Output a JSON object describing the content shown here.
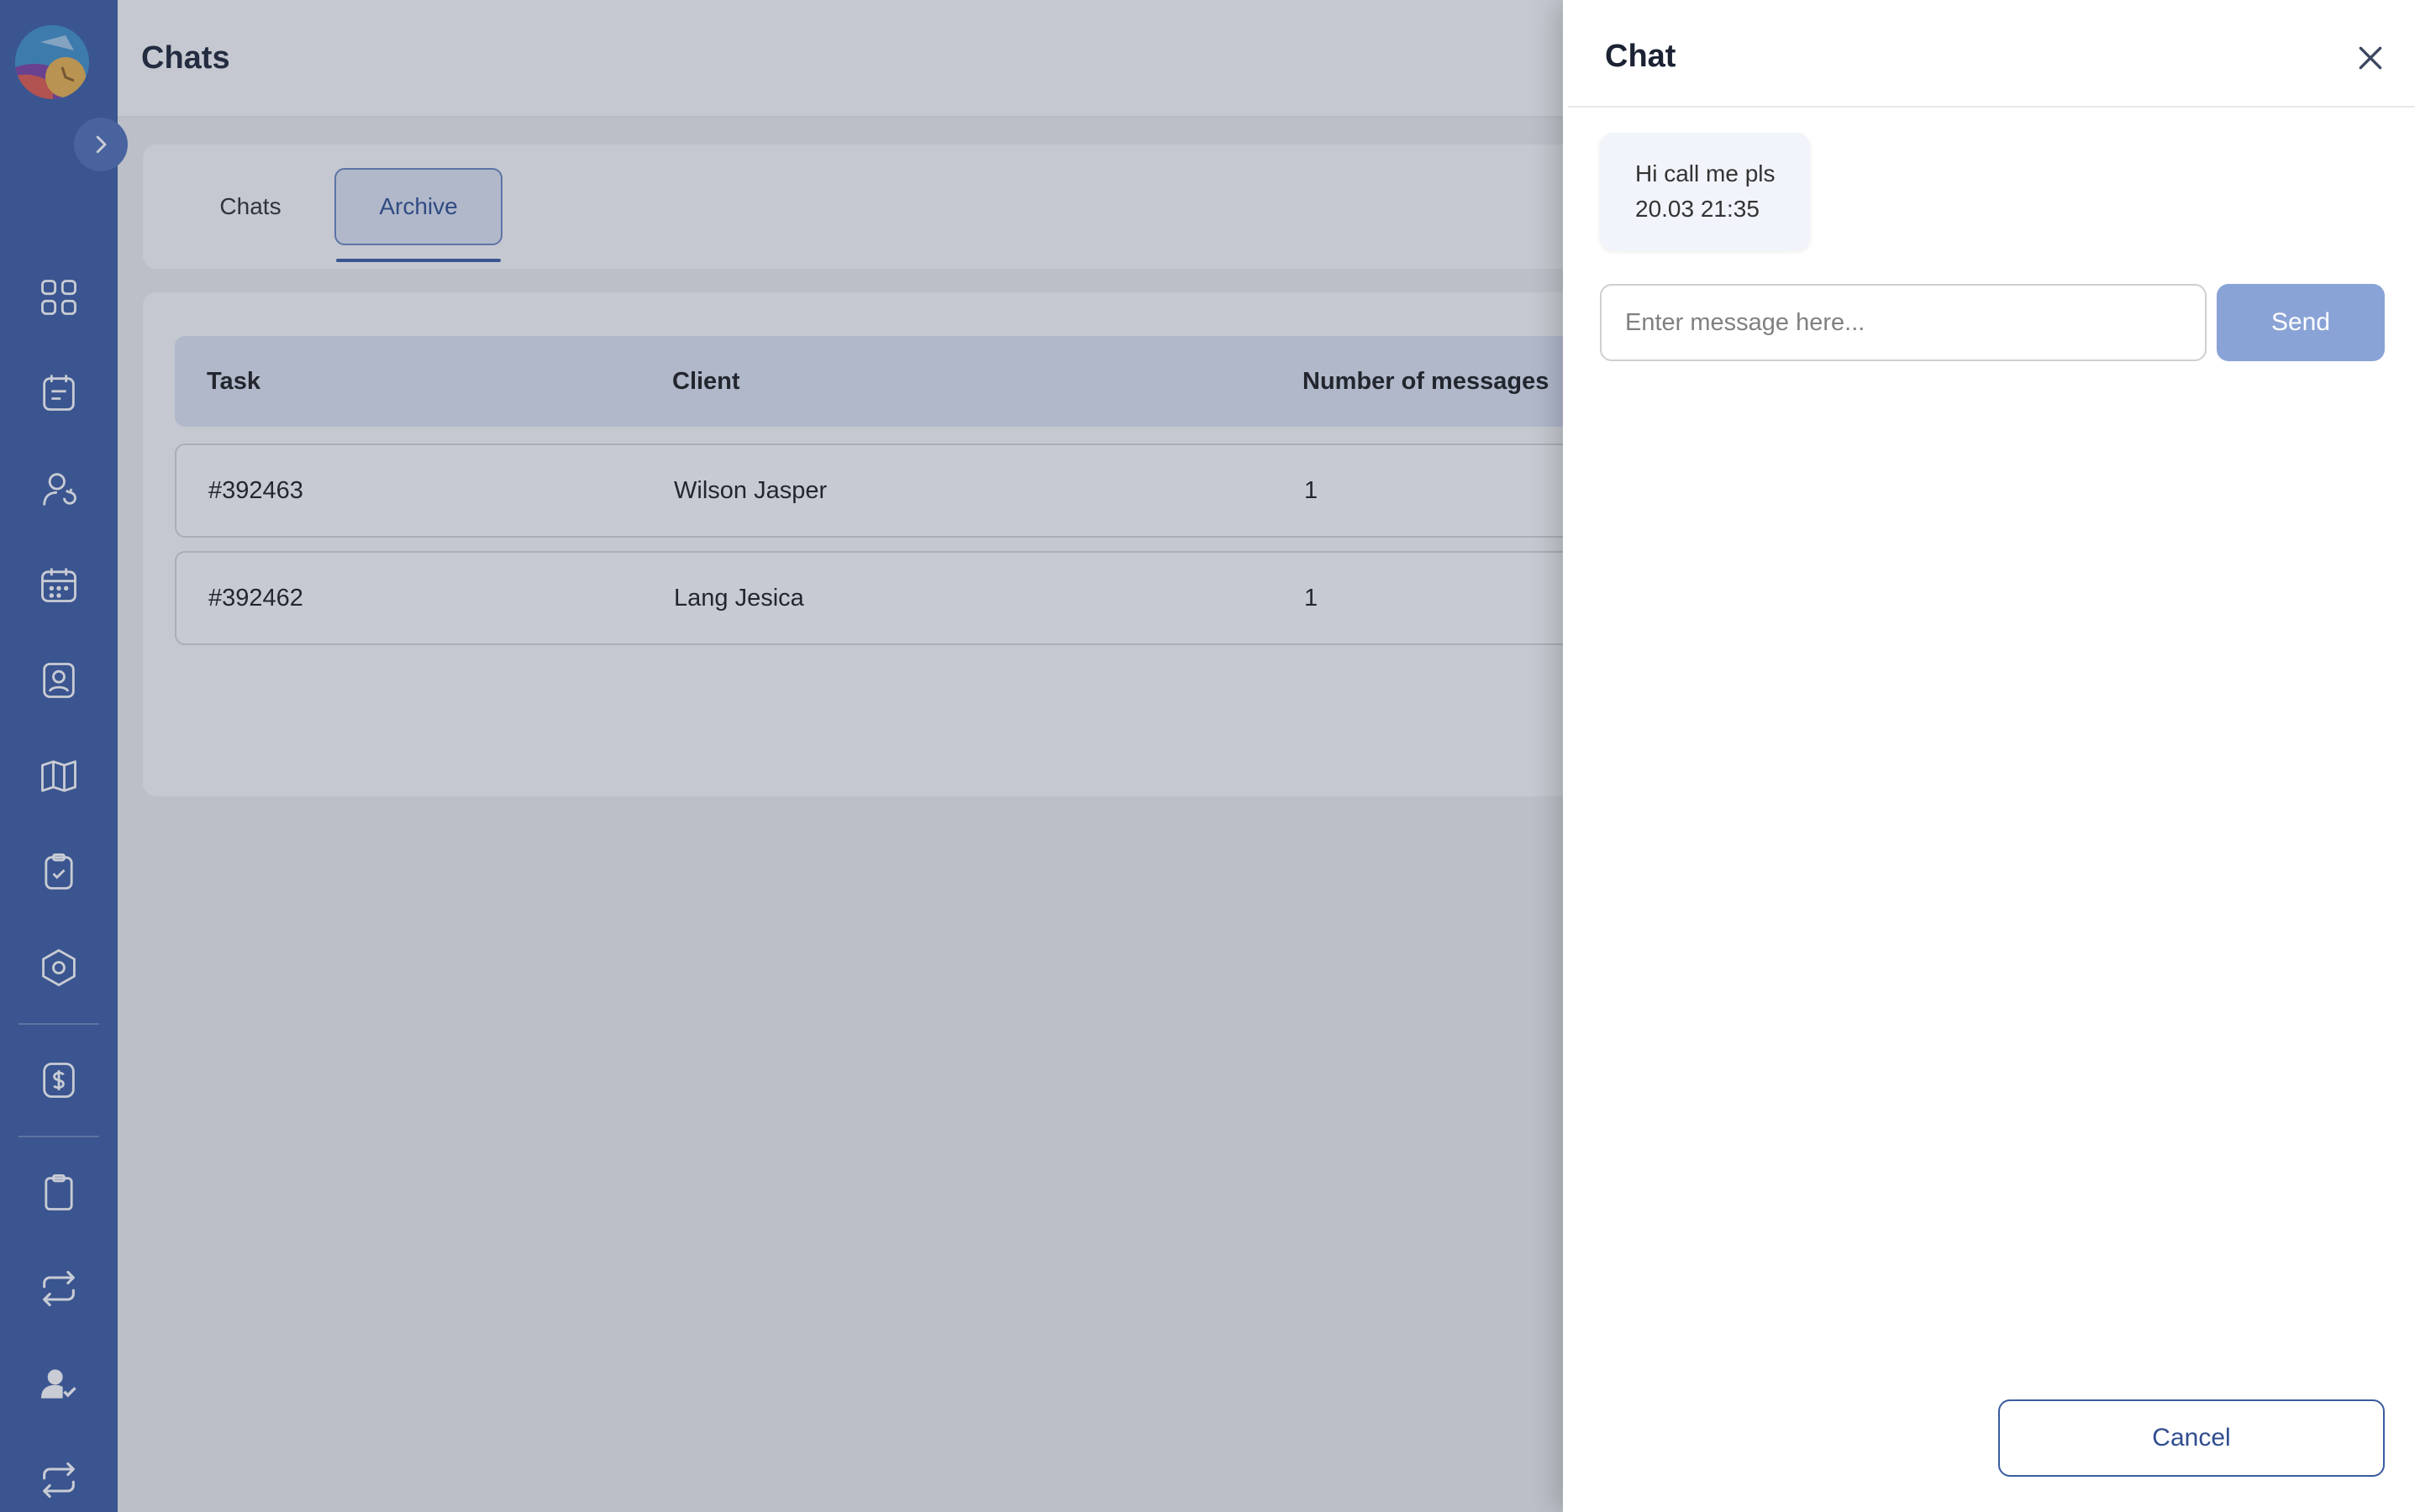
{
  "header": {
    "title": "Chats"
  },
  "tabs": [
    {
      "label": "Chats",
      "active": false
    },
    {
      "label": "Archive",
      "active": true
    }
  ],
  "table": {
    "columns": [
      "Task",
      "Client",
      "Number of messages"
    ],
    "rows": [
      {
        "task": "#392463",
        "client": "Wilson Jasper",
        "messages": "1"
      },
      {
        "task": "#392462",
        "client": "Lang Jesica",
        "messages": "1"
      }
    ]
  },
  "sidebar": {
    "items": [
      {
        "icon": "grid-icon"
      },
      {
        "icon": "tasks-icon"
      },
      {
        "icon": "user-sync-icon"
      },
      {
        "icon": "calendar-icon"
      },
      {
        "icon": "user-badge-icon"
      },
      {
        "icon": "map-icon"
      },
      {
        "icon": "clipboard-check-icon"
      },
      {
        "icon": "settings-hex-icon"
      },
      {
        "icon": "dollar-icon"
      },
      {
        "icon": "clipboard-icon"
      },
      {
        "icon": "repeat-icon"
      },
      {
        "icon": "user-check-icon"
      },
      {
        "icon": "repeat-icon"
      }
    ]
  },
  "chat": {
    "title": "Chat",
    "messages": [
      {
        "text": "Hi call me pls",
        "time": "20.03 21:35"
      }
    ],
    "input_placeholder": "Enter message here...",
    "send_label": "Send",
    "cancel_label": "Cancel"
  },
  "colors": {
    "sidebar": "#3a5ba0",
    "accent": "#2f4d8f",
    "send_button": "#8aa3d6",
    "table_header": "#dde4f2"
  }
}
